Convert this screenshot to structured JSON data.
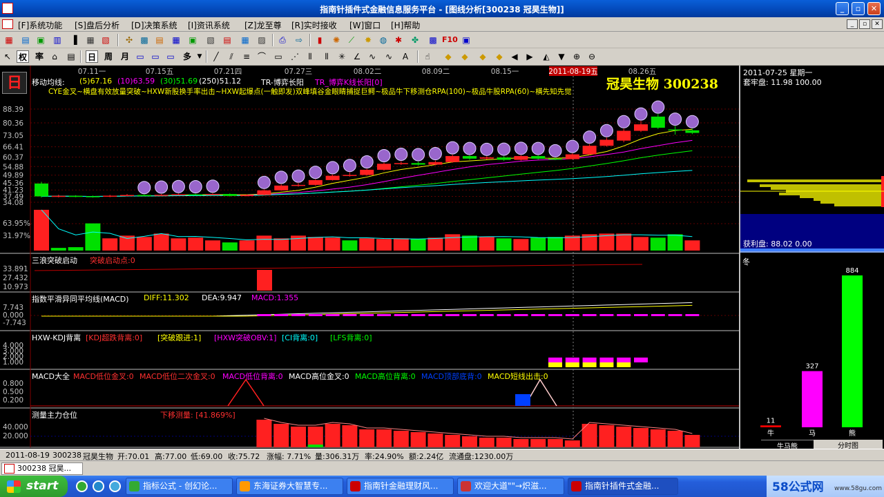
{
  "window": {
    "title": "指南针插件式金融信息服务平台 - [图线分析[300238 冠昊生物]]"
  },
  "menu": [
    "[F]系统功能",
    "[S]盘后分析",
    "[D]决策系统",
    "[I]资讯系统",
    "[Z]龙至尊",
    "[R]实时接收",
    "[W]窗口",
    "[H]帮助"
  ],
  "toolbar2": {
    "quan": "权",
    "shuai": "率",
    "day": "日",
    "week": "周",
    "month": "月",
    "duo": "多"
  },
  "period_badge": "日",
  "ma": {
    "label": "移动均线:",
    "ma5": "(5)67.16",
    "ma10": "(10)63.59",
    "ma30": "(30)51.69",
    "ma250": "(250)51.12",
    "tr1": "TR-博弈长阳",
    "tr2": "TR_博弈K线长阳[0]",
    "colors": {
      "ma5": "#ffff00",
      "ma10": "#ff00ff",
      "ma30": "#00ff00",
      "ma250": "#ffffff"
    }
  },
  "signals_line": "CYE金叉~横盘有效放量突破~HXW新股换手率出击~HXW起爆点(一触即发)双峰填谷金眼睛捕捉巨鳄~极品牛下移测仓RPA(100)~极品牛股RPA(60)~横先知先觉",
  "stock_name_big": "冠昊生物  300238",
  "dates": [
    "07.11一",
    "07.15五",
    "07.21四",
    "07.27三",
    "08.02二",
    "08.09二",
    "08.15一",
    "2011-08-19五",
    "08.26五"
  ],
  "price_axis": [
    "88.39",
    "80.36",
    "73.05",
    "66.41",
    "60.37",
    "54.88",
    "49.89",
    "45.36",
    "41.23",
    "37.49",
    "34.08"
  ],
  "volume_axis": [
    "63.95%",
    "31.97%"
  ],
  "panels": {
    "p1": {
      "title": "三浪突破启动",
      "sub": "突破启动点:0",
      "axis": [
        "33.891",
        "27.432",
        "10.973"
      ]
    },
    "p2": {
      "title": "指数平滑异同平均线(MACD)",
      "diff": "DIFF:11.302",
      "dea": "DEA:9.947",
      "macd": "MACD:1.355",
      "axis": [
        "7.743",
        "0.000",
        "-7.743"
      ]
    },
    "p3": {
      "title": "HXW-KDJ背离",
      "items": [
        "[KDJ超跌背离:0]",
        "[突破跟进:1]",
        "[HXW突破OBV:1]",
        "[CI背离:0]",
        "[LFS背离:0]"
      ],
      "axis": [
        "4.000",
        "3.000",
        "2.000",
        "1.000"
      ]
    },
    "p4": {
      "title": "MACD大全",
      "items": [
        "MACD低位金叉:0",
        "MACD低位二次金叉:0",
        "MACD低位背离:0",
        "MACD高位金叉:0",
        "MACD高位背离:0",
        "MACD顶部底背:0",
        "MACD短线出击:0"
      ],
      "axis": [
        "0.800",
        "0.500",
        "0.200"
      ]
    },
    "p5": {
      "title": "测量主力仓位",
      "sub": "下移测量: [41.869%]",
      "axis": [
        "40.000",
        "20.000"
      ]
    }
  },
  "right": {
    "date": "2011-07-25 星期一",
    "tp_label": "套牢盘: 11.98 100.00",
    "hl_label": "获利盘: 88.02 0.00",
    "season": "冬",
    "bars": [
      {
        "label": "牛",
        "value": 11,
        "color": "#ff0000"
      },
      {
        "label": "马",
        "value": 327,
        "color": "#ff00ff"
      },
      {
        "label": "熊",
        "value": 884,
        "color": "#00ff00"
      }
    ],
    "tab1": "牛马熊",
    "tab2": "分时图"
  },
  "status": {
    "date": "2011-08-19",
    "code": "300238",
    "name": "冠昊生物",
    "open": "开:70.01",
    "high": "高:77.00",
    "low": "低:69.00",
    "close": "收:75.72",
    "chg": "涨幅: 7.71%",
    "vol": "量:306.31万",
    "rate": "率:24.90%",
    "amt": "额:2.24亿",
    "float": "流通盘:1230.00万"
  },
  "doc_tab": "300238 冠昊...",
  "taskbar": {
    "start": "start",
    "tasks": [
      "指标公式 - 创幻论...",
      "东海证券大智慧专...",
      "指南针金融理财风...",
      "欢迎大道\"\"→炽滋...",
      "指南针插件式金融..."
    ],
    "logo": "58公式网",
    "url": "www.58gu.com"
  },
  "chart_data": {
    "type": "candlestick",
    "dates": [
      "07.11一",
      "07.15五",
      "07.21四",
      "07.27三",
      "08.02二",
      "08.09二",
      "08.15一",
      "2011-08-19五",
      "08.26五"
    ],
    "candles": [
      [
        45.0,
        37.5,
        46.0,
        36.8
      ],
      [
        37.2,
        37.8,
        38.5,
        36.9
      ],
      [
        37.8,
        37.4,
        38.2,
        37.0
      ],
      [
        37.6,
        37.2,
        38.0,
        36.8
      ],
      [
        37.3,
        37.9,
        38.4,
        37.0
      ],
      [
        37.9,
        38.3,
        38.9,
        37.6
      ],
      [
        38.3,
        38.0,
        38.6,
        37.6
      ],
      [
        38.0,
        38.4,
        38.9,
        37.7
      ],
      [
        38.4,
        38.7,
        39.2,
        38.1
      ],
      [
        38.7,
        38.5,
        39.1,
        38.1
      ],
      [
        38.5,
        38.9,
        39.4,
        38.2
      ],
      [
        38.9,
        37.8,
        39.2,
        37.4
      ],
      [
        37.8,
        38.3,
        38.7,
        37.5
      ],
      [
        38.3,
        41.0,
        41.6,
        38.1
      ],
      [
        41.0,
        43.8,
        44.6,
        40.8
      ],
      [
        43.8,
        44.2,
        45.3,
        43.2
      ],
      [
        44.2,
        47.0,
        47.5,
        43.8
      ],
      [
        47.0,
        49.5,
        50.2,
        46.7
      ],
      [
        49.5,
        50.0,
        51.5,
        49.0
      ],
      [
        50.0,
        53.0,
        53.6,
        49.6
      ],
      [
        53.0,
        56.5,
        57.2,
        52.5
      ],
      [
        56.5,
        56.9,
        58.0,
        55.8
      ],
      [
        56.9,
        56.0,
        57.8,
        55.4
      ],
      [
        56.0,
        57.5,
        58.4,
        55.6
      ],
      [
        57.5,
        61.0,
        61.8,
        57.1
      ],
      [
        61.0,
        59.5,
        61.4,
        58.8
      ],
      [
        59.5,
        60.2,
        60.9,
        59.0
      ],
      [
        60.2,
        58.8,
        61.0,
        58.2
      ],
      [
        58.8,
        61.0,
        61.5,
        58.3
      ],
      [
        61.0,
        59.5,
        61.4,
        58.9
      ],
      [
        59.5,
        59.2,
        60.1,
        58.6
      ],
      [
        59.2,
        62.0,
        62.6,
        59.0
      ],
      [
        62.0,
        67.0,
        68.0,
        61.6
      ],
      [
        67.0,
        70.5,
        71.8,
        66.5
      ],
      [
        70.01,
        75.72,
        77.0,
        69.0
      ],
      [
        75.7,
        79.5,
        81.5,
        75.0
      ],
      [
        84.0,
        77.5,
        85.5,
        76.8
      ],
      [
        76.5,
        76.0,
        78.5,
        73.5
      ],
      [
        76.0,
        74.5,
        77.0,
        73.8
      ]
    ],
    "volume_pct": [
      60,
      4,
      5,
      40,
      18,
      22,
      20,
      25,
      18,
      19,
      15,
      12,
      15,
      22,
      18,
      22,
      20,
      19,
      15,
      18,
      17,
      18,
      17,
      19,
      24,
      22,
      20,
      18,
      17,
      19,
      20,
      22,
      24,
      25,
      25,
      20,
      19,
      24,
      15
    ],
    "volume_red": [
      1,
      0,
      0,
      0,
      1,
      1,
      1,
      1,
      1,
      1,
      1,
      0,
      1,
      1,
      1,
      1,
      1,
      1,
      0,
      1,
      1,
      1,
      0,
      1,
      1,
      0,
      1,
      0,
      1,
      0,
      0,
      1,
      1,
      1,
      1,
      1,
      0,
      0,
      1
    ],
    "ylim": [
      34.08,
      88.39
    ]
  }
}
